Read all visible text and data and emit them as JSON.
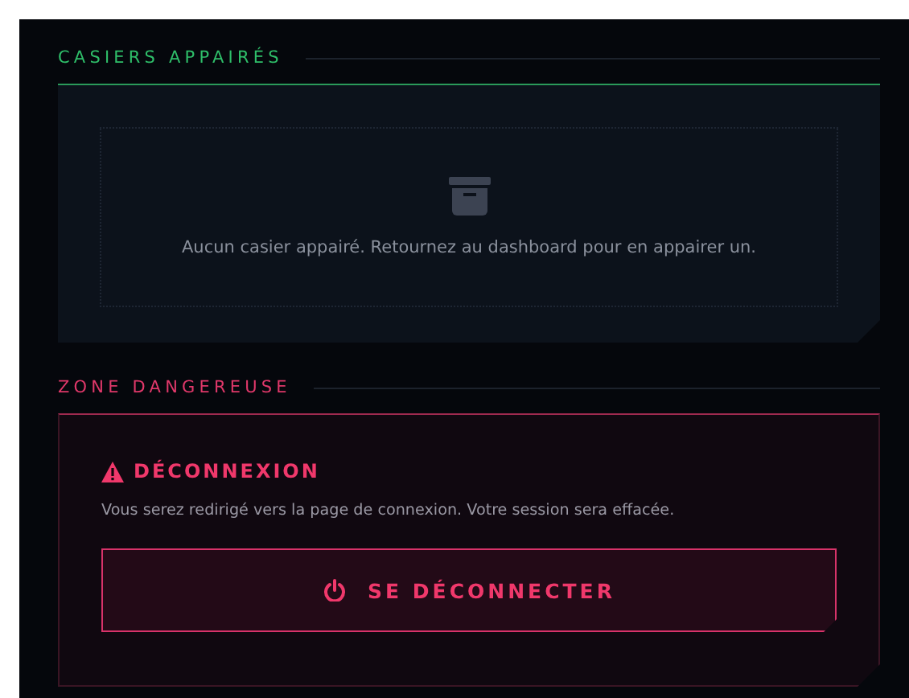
{
  "sections": [
    {
      "kind": "list",
      "title": "CASIERS APPAIRÉS",
      "empty_message": "Aucun casier appairé. Retournez au dashboard pour en appairer un."
    },
    {
      "kind": "danger",
      "title": "ZONE DANGEREUSE",
      "heading": "DÉCONNEXION",
      "description": "Vous serez redirigé vers la page de connexion. Votre session sera effacée.",
      "button": "SE DÉCONNECTER"
    }
  ]
}
